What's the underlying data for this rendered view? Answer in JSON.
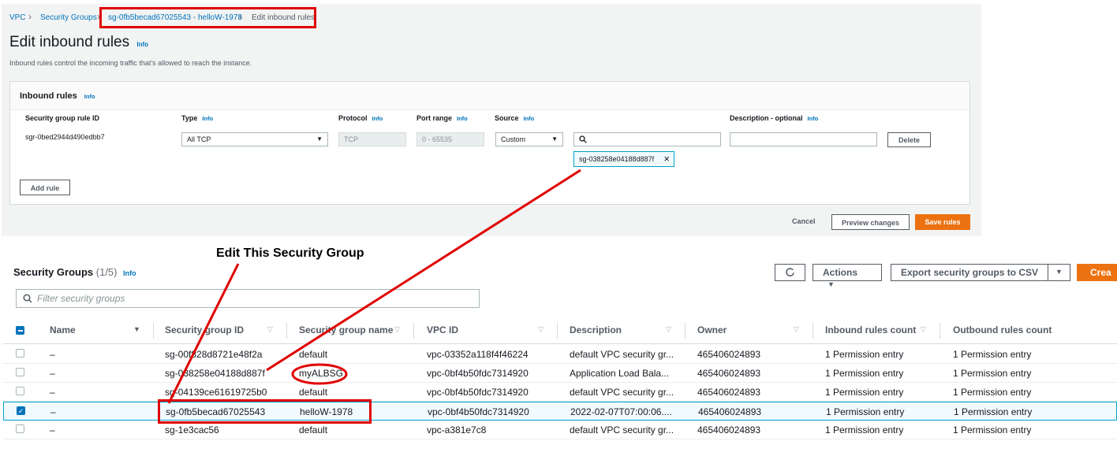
{
  "breadcrumb": {
    "vpc": "VPC",
    "security_groups": "Security Groups",
    "current_sg": "sg-0fb5becad67025543 - helloW-1978",
    "current_page": "Edit inbound rules"
  },
  "header": {
    "title": "Edit inbound rules",
    "info": "Info",
    "subtitle": "Inbound rules control the incoming traffic that's allowed to reach the instance."
  },
  "inbound": {
    "title": "Inbound rules",
    "info": "Info",
    "columns": {
      "rule_id": "Security group rule ID",
      "type": "Type",
      "protocol": "Protocol",
      "port_range": "Port range",
      "source": "Source",
      "description": "Description - optional"
    },
    "rule": {
      "id": "sgr-0bed2944d490edbb7",
      "type": "All TCP",
      "protocol": "TCP",
      "port_range": "0 - 65535",
      "source": "Custom",
      "source_token": "sg-038258e04188d887f",
      "delete": "Delete"
    },
    "add_rule": "Add rule"
  },
  "footer": {
    "cancel": "Cancel",
    "preview": "Preview changes",
    "save": "Save rules"
  },
  "annotation": {
    "text": "Edit This Security Group"
  },
  "sg_list": {
    "title": "Security Groups",
    "count": "(1/5)",
    "info": "Info",
    "actions": "Actions",
    "export": "Export security groups to CSV",
    "create": "Crea",
    "filter_placeholder": "Filter security groups",
    "columns": [
      "Name",
      "Security group ID",
      "Security group name",
      "VPC ID",
      "Description",
      "Owner",
      "Inbound rules count",
      "Outbound rules count"
    ],
    "rows": [
      {
        "name": "–",
        "sg_id": "sg-00f828d8721e48f2a",
        "sg_name": "default",
        "vpc": "vpc-03352a118f4f46224",
        "desc": "default VPC security gr...",
        "owner": "465406024893",
        "inbound": "1 Permission entry",
        "outbound": "1 Permission entry",
        "checked": false
      },
      {
        "name": "–",
        "sg_id": "sg-038258e04188d887f",
        "sg_name": "myALBSG",
        "vpc": "vpc-0bf4b50fdc7314920",
        "desc": "Application Load Bala...",
        "owner": "465406024893",
        "inbound": "1 Permission entry",
        "outbound": "1 Permission entry",
        "checked": false
      },
      {
        "name": "–",
        "sg_id": "sg-04139ce61619725b0",
        "sg_name": "default",
        "vpc": "vpc-0bf4b50fdc7314920",
        "desc": "default VPC security gr...",
        "owner": "465406024893",
        "inbound": "1 Permission entry",
        "outbound": "1 Permission entry",
        "checked": false
      },
      {
        "name": "–",
        "sg_id": "sg-0fb5becad67025543",
        "sg_name": "helloW-1978",
        "vpc": "vpc-0bf4b50fdc7314920",
        "desc": "2022-02-07T07:00:06....",
        "owner": "465406024893",
        "inbound": "1 Permission entry",
        "outbound": "1 Permission entry",
        "checked": true
      },
      {
        "name": "–",
        "sg_id": "sg-1e3cac56",
        "sg_name": "default",
        "vpc": "vpc-a381e7c8",
        "desc": "default VPC security gr...",
        "owner": "465406024893",
        "inbound": "1 Permission entry",
        "outbound": "1 Permission entry",
        "checked": false
      }
    ]
  },
  "colors": {
    "link": "#0073bb",
    "accent": "#ec7211",
    "annotation_red": "#e00000"
  }
}
